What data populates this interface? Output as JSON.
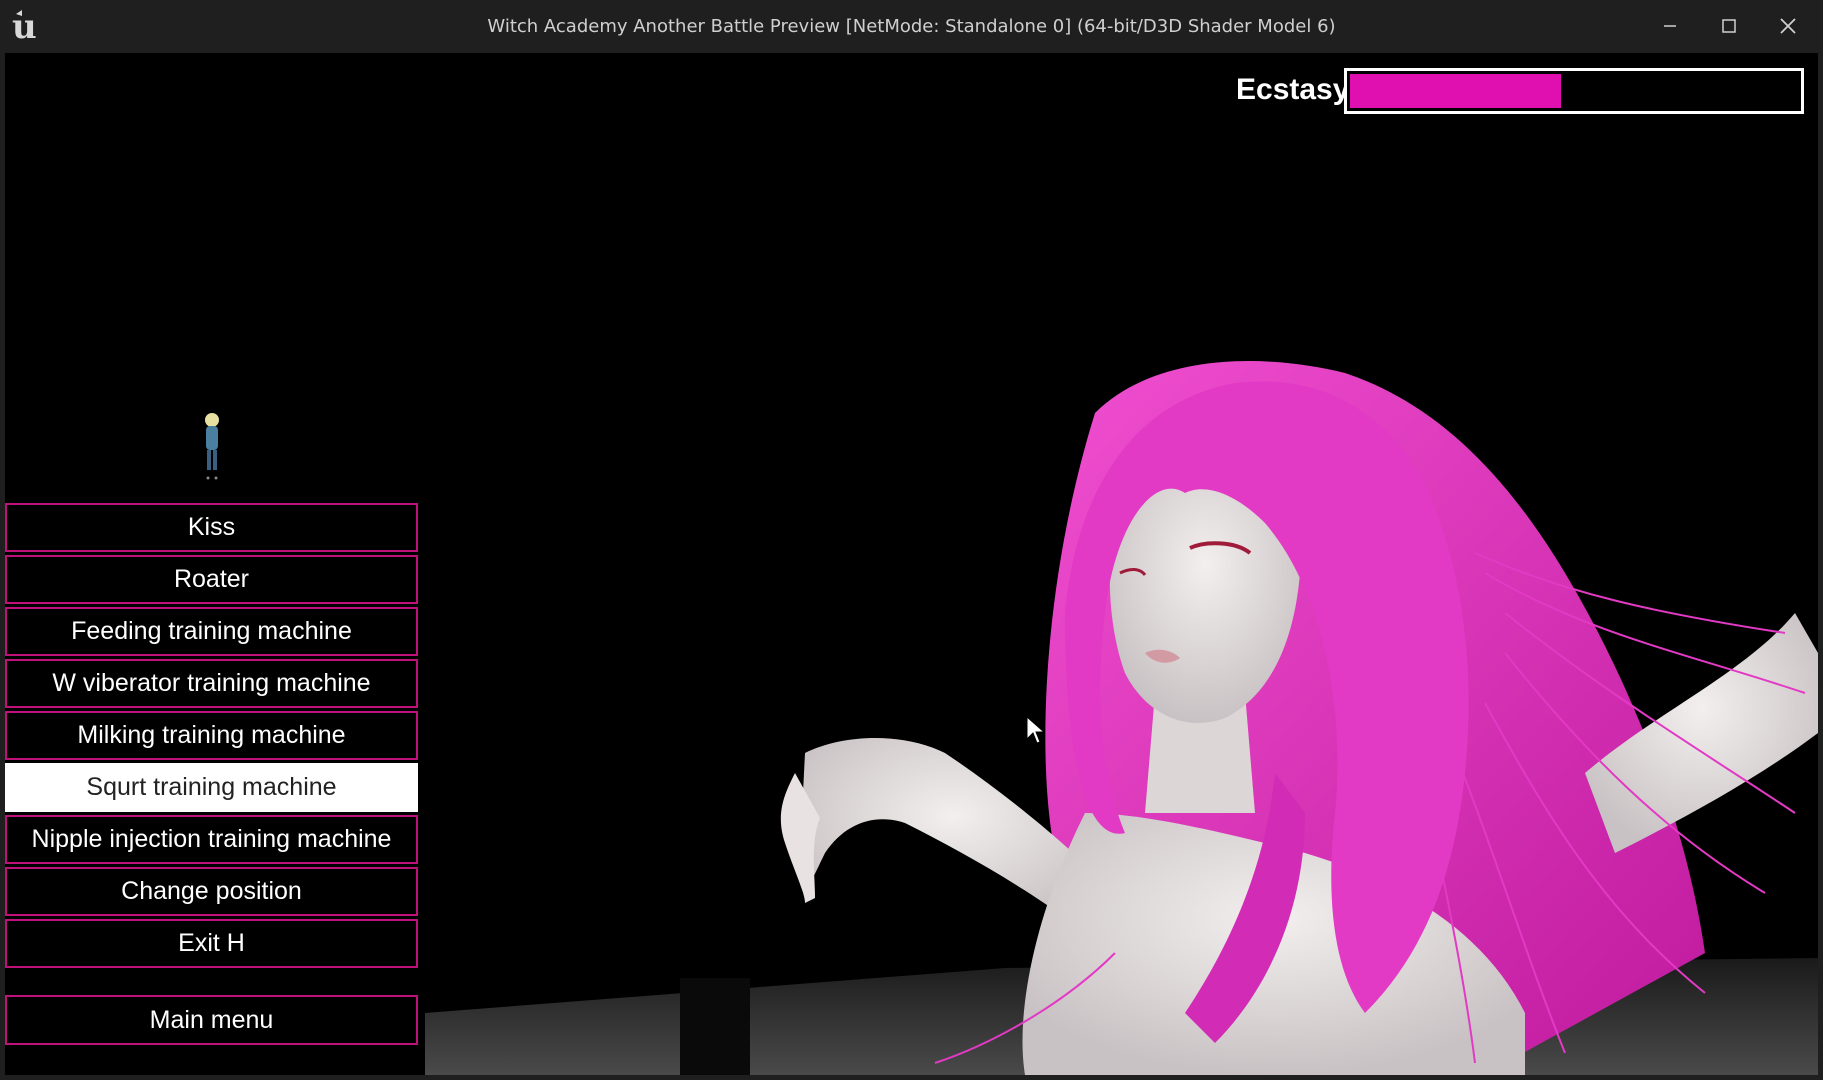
{
  "window": {
    "title": "Witch Academy Another Battle Preview [NetMode: Standalone 0]  (64-bit/D3D Shader Model 6)",
    "logo_icon": "unreal-engine-logo",
    "controls": [
      "minimize-icon",
      "maximize-icon",
      "close-icon"
    ]
  },
  "hud": {
    "ecstasy_label": "Ecstasy",
    "ecstasy_value": 0.47,
    "ecstasy_color": "#e010b0"
  },
  "menu": {
    "items": [
      {
        "label": "Kiss",
        "selected": false
      },
      {
        "label": "Roater",
        "selected": false
      },
      {
        "label": "Feeding training machine",
        "selected": false
      },
      {
        "label": "W viberator training machine",
        "selected": false
      },
      {
        "label": "Milking training machine",
        "selected": false
      },
      {
        "label": "Squrt training machine",
        "selected": true
      },
      {
        "label": "Nipple injection training machine",
        "selected": false
      },
      {
        "label": "Change position",
        "selected": false
      },
      {
        "label": "Exit H",
        "selected": false
      }
    ],
    "main_menu_label": "Main menu",
    "border_color": "#c0117a"
  },
  "scene": {
    "hair_color": "#e23ac4",
    "background": "#000000"
  }
}
